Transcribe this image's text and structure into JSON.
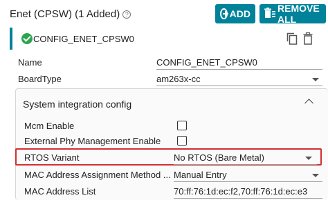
{
  "header": {
    "title": "Enet (CPSW) (1 Added)",
    "help_glyph": "?",
    "add_label": "ADD",
    "remove_label": "REMOVE ALL"
  },
  "instance": {
    "name": "CONFIG_ENET_CPSW0"
  },
  "fields": {
    "name_label": "Name",
    "name_value": "CONFIG_ENET_CPSW0",
    "boardtype_label": "BoardType",
    "boardtype_value": "am263x-cc"
  },
  "system_integration": {
    "title": "System integration config",
    "mcm_enable_label": "Mcm Enable",
    "mcm_enable_checked": false,
    "ext_phy_label": "External Phy Management Enable",
    "ext_phy_checked": false,
    "rtos_variant_label": "RTOS Variant",
    "rtos_variant_value": "No RTOS (Bare Metal)",
    "mac_assign_label": "MAC Address Assignment Method ...",
    "mac_assign_value": "Manual Entry",
    "mac_list_label": "MAC Address List",
    "mac_list_value": "70:ff:76:1d:ec:f2,70:ff:76:1d:ec:e3"
  },
  "colors": {
    "accent": "#00829b",
    "highlight": "#d32f2f",
    "success": "#2da44e"
  }
}
